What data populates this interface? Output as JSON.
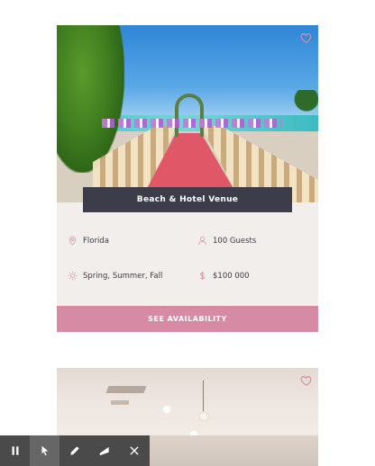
{
  "venue_card": {
    "title": "Beach & Hotel Venue",
    "location": "Florida",
    "guests": "100 Guests",
    "seasons": "Spring, Summer, Fall",
    "price": "$100 000",
    "cta_label": "SEE AVAILABILITY",
    "favorited": false
  },
  "colors": {
    "accent_pink": "#d78aa4",
    "title_bar": "#3d3c4b",
    "card_background": "#f2eeec",
    "toolbar": "#4a4a4a"
  },
  "icons": {
    "favorite": "heart-outline-icon",
    "location": "map-pin-icon",
    "guests": "person-icon",
    "seasons": "sun-icon",
    "price": "dollar-icon"
  },
  "toolbar": {
    "tools": [
      "pause-icon",
      "cursor-icon",
      "pencil-icon",
      "eraser-icon",
      "close-icon"
    ],
    "active_tool": "cursor-icon"
  }
}
